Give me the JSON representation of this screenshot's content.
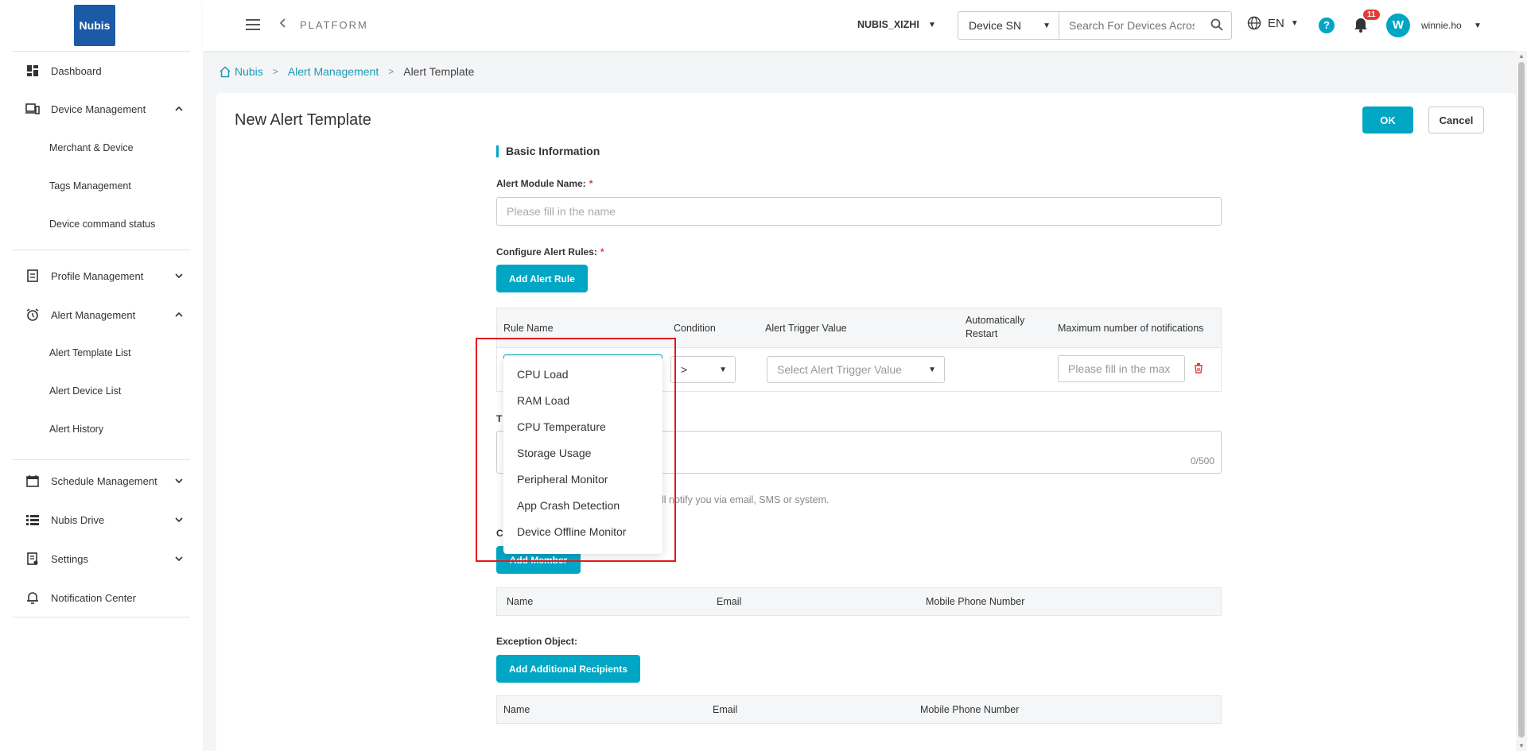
{
  "brand": {
    "logo_text": "Nubis"
  },
  "sidebar": {
    "items": [
      {
        "label": "Dashboard"
      },
      {
        "label": "Device Management",
        "chevron": "^"
      },
      {
        "label": "Profile Management",
        "chevron": "⌄"
      },
      {
        "label": "Alert Management",
        "chevron": "^"
      },
      {
        "label": "Schedule Management",
        "chevron": "⌄"
      },
      {
        "label": "Nubis Drive",
        "chevron": "⌄"
      },
      {
        "label": "Settings",
        "chevron": "⌄"
      },
      {
        "label": "Notification Center"
      }
    ],
    "device_sub": [
      "Merchant & Device",
      "Tags Management",
      "Device command status"
    ],
    "alert_sub": [
      "Alert Template List",
      "Alert Device List",
      "Alert History"
    ]
  },
  "header": {
    "platform": "PLATFORM",
    "org": "NUBIS_XIZHI",
    "device_select": "Device SN",
    "search_placeholder": "Search For Devices Across",
    "lang": "EN",
    "help": "?",
    "notif_count": "11",
    "avatar_letter": "W",
    "username": "winnie.ho"
  },
  "breadcrumb": {
    "home": "Nubis",
    "parent": "Alert Management",
    "current": "Alert Template"
  },
  "page": {
    "title": "New Alert Template",
    "ok": "OK",
    "cancel": "Cancel"
  },
  "form": {
    "basic_info": "Basic Information",
    "module_name_label": "Alert Module Name:",
    "module_name_placeholder": "Please fill in the name",
    "rules_label": "Configure Alert Rules:",
    "add_rule": "Add Alert Rule",
    "rule_columns": {
      "rule_name": "Rule Name",
      "condition": "Condition",
      "trigger": "Alert Trigger Value",
      "restart_1": "Automatically",
      "restart_2": "Restart",
      "max_notif": "Maximum number of notifications"
    },
    "condition_value": ">",
    "trigger_placeholder": "Select Alert Trigger Value",
    "max_placeholder": "Please fill in the max",
    "textarea_label_fragment": "T",
    "counter": "0/500",
    "hint_fragment": "ll notify you via email, SMS or system.",
    "contacts_label_fragment": "C",
    "add_member": "Add Member",
    "member_columns": {
      "name": "Name",
      "email": "Email",
      "phone": "Mobile Phone Number"
    },
    "exception_label": "Exception Object:",
    "add_recipients": "Add Additional Recipients",
    "exception_columns": {
      "name": "Name",
      "email": "Email",
      "phone": "Mobile Phone Number"
    }
  },
  "dropdown": {
    "options": [
      "CPU Load",
      "RAM Load",
      "CPU Temperature",
      "Storage Usage",
      "Peripheral Monitor",
      "App Crash Detection",
      "Device Offline Monitor"
    ]
  },
  "colors": {
    "accent": "#00a6c4",
    "highlight": "#e3191f",
    "badge": "#e53935"
  }
}
